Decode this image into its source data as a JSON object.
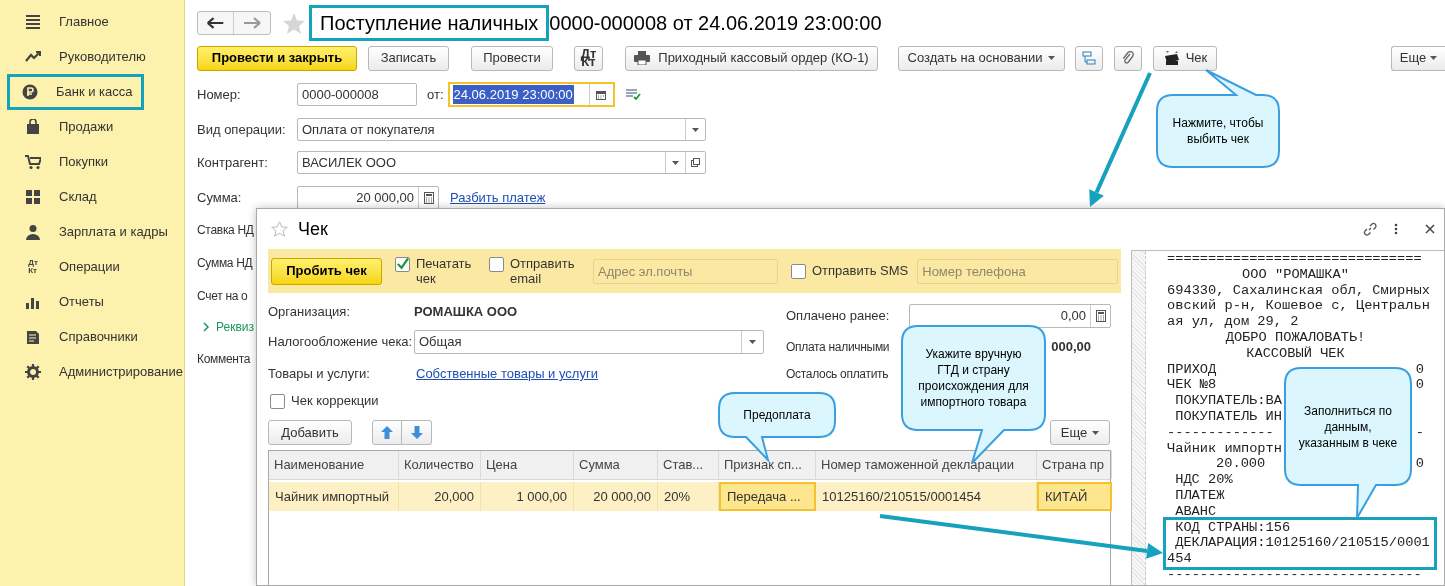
{
  "sidebar": {
    "items": [
      {
        "label": "Главное",
        "highlighted": false
      },
      {
        "label": "Руководителю",
        "highlighted": false
      },
      {
        "label": "Банк и касса",
        "highlighted": true
      },
      {
        "label": "Продажи",
        "highlighted": false
      },
      {
        "label": "Покупки",
        "highlighted": false
      },
      {
        "label": "Склад",
        "highlighted": false
      },
      {
        "label": "Зарплата и кадры",
        "highlighted": false
      },
      {
        "label": "Операции",
        "highlighted": false,
        "icon_text": "Дт\nКт"
      },
      {
        "label": "Отчеты",
        "highlighted": false
      },
      {
        "label": "Справочники",
        "highlighted": false
      },
      {
        "label": "Администрирование",
        "highlighted": false
      }
    ]
  },
  "document": {
    "title": "Поступление наличных",
    "title_highlighted": true,
    "subtitle": "0000-000008 от 24.06.2019 23:00:00",
    "toolbar": [
      {
        "kind": "primary",
        "label": "Провести и закрыть"
      },
      {
        "kind": "button",
        "label": "Записать"
      },
      {
        "kind": "button",
        "label": "Провести"
      },
      {
        "kind": "dtkt",
        "label": "Дт\nКт"
      },
      {
        "kind": "print",
        "label": "Приходный кассовый ордер (КО-1)"
      },
      {
        "kind": "menu",
        "label": "Создать на основании"
      },
      {
        "kind": "structure"
      },
      {
        "kind": "clip"
      },
      {
        "kind": "receipt",
        "label": "Чек"
      },
      {
        "kind": "more",
        "label": "Еще"
      }
    ],
    "number": {
      "label": "Номер:",
      "value": "0000-000008"
    },
    "date": {
      "label": "от:",
      "value": "24.06.2019 23:00:00",
      "selected": true
    },
    "operation": {
      "label": "Вид операции:",
      "value": "Оплата от покупателя"
    },
    "counterparty": {
      "label": "Контрагент:",
      "value": "ВАСИЛЕК ООО"
    },
    "amount": {
      "label": "Сумма:",
      "value": "20 000,00",
      "link": "Разбить платеж"
    },
    "partial_rows": [
      {
        "kind": "label",
        "text": "Ставка НД"
      },
      {
        "kind": "label",
        "text": "Сумма НД"
      },
      {
        "kind": "label",
        "text": "Счет на о"
      },
      {
        "kind": "group",
        "text": "Реквиз",
        "expanded": false
      },
      {
        "kind": "label",
        "text": "Коммента"
      }
    ]
  },
  "receipt_dialog": {
    "title": "Чек",
    "command_bar": {
      "button": "Пробить чек",
      "print": {
        "label": "Печатать\nчек",
        "checked": true
      },
      "email": {
        "label": "Отправить\nemail",
        "checked": false,
        "placeholder": "Адрес эл.почты"
      },
      "sms": {
        "label": "Отправить SMS",
        "checked": false,
        "placeholder": "Номер телефона"
      }
    },
    "organization": {
      "label": "Организация:",
      "value": "РОМАШКА ООО"
    },
    "taxation": {
      "label": "Налогообложение чека:",
      "value": "Общая"
    },
    "goods": {
      "label": "Товары и услуги:",
      "link": "Собственные товары и услуги"
    },
    "correction": {
      "label": "Чек коррекции",
      "checked": false
    },
    "paid_before": {
      "label": "Оплачено ранее:",
      "value": "0,00"
    },
    "cash": {
      "label": "Оплата наличными",
      "value": "000,00"
    },
    "remaining": {
      "label": "Осталось оплатить"
    },
    "add_button": "Добавить",
    "more_button": "Еще",
    "table": {
      "columns": [
        {
          "label": "Наименование",
          "numeric": false
        },
        {
          "label": "Количество",
          "numeric": true
        },
        {
          "label": "Цена",
          "numeric": true
        },
        {
          "label": "Сумма",
          "numeric": true
        },
        {
          "label": "Став...",
          "numeric": false
        },
        {
          "label": "Признак сп...",
          "numeric": false
        },
        {
          "label": "Номер таможенной декларации",
          "numeric": false
        },
        {
          "label": "Страна пр",
          "numeric": false
        }
      ],
      "rows": [
        {
          "selected": true,
          "cells": [
            {
              "text": "Чайник импортный",
              "highlighted": false
            },
            {
              "text": "20,000",
              "highlighted": false
            },
            {
              "text": "1 000,00",
              "highlighted": false
            },
            {
              "text": "20 000,00",
              "highlighted": false
            },
            {
              "text": "20%",
              "highlighted": false
            },
            {
              "text": "Передача ...",
              "highlighted": true
            },
            {
              "text": "10125160/210515/0001454",
              "highlighted": false
            },
            {
              "text": "КИТАЙ",
              "highlighted": true
            }
          ]
        }
      ]
    }
  },
  "receipt": {
    "lines": [
      {
        "text": "===============================",
        "kind": "plain",
        "highlighted": false
      },
      {
        "text": "ООО \"РОМАШКА\"",
        "kind": "centered",
        "highlighted": false
      },
      {
        "text": "694330, Сахалинская обл, Смирных",
        "kind": "plain",
        "highlighted": false
      },
      {
        "text": "овский р-н, Кошевое с, Центральн",
        "kind": "plain",
        "highlighted": false
      },
      {
        "text": "ая ул, дом 29, 2",
        "kind": "plain",
        "highlighted": false
      },
      {
        "text": "ДОБРО ПОЖАЛОВАТЬ!",
        "kind": "centered",
        "highlighted": false
      },
      {
        "text": "КАССОВЫЙ ЧЕК",
        "kind": "centered",
        "highlighted": false
      },
      {
        "text": "ПРИХОД",
        "tail": "0",
        "kind": "plain",
        "highlighted": false
      },
      {
        "text": "ЧЕК №8",
        "tail": "0",
        "kind": "plain",
        "highlighted": false
      },
      {
        "text": "ПОКУПАТЕЛЬ:ВА",
        "kind": "indented",
        "highlighted": false
      },
      {
        "text": "ПОКУПАТЕЛЬ ИН",
        "kind": "indented",
        "highlighted": false
      },
      {
        "text": "-------------",
        "tail": "-",
        "kind": "plain",
        "highlighted": false
      },
      {
        "text": "Чайник импортн",
        "kind": "plain",
        "highlighted": false
      },
      {
        "text": "20.000",
        "tail": "0",
        "kind": "quantity",
        "highlighted": false
      },
      {
        "text": "НДС 20%",
        "kind": "indented",
        "highlighted": false
      },
      {
        "text": "ПЛАТЕЖ",
        "kind": "indented",
        "highlighted": false
      },
      {
        "text": "АВАНС",
        "kind": "indented",
        "highlighted": false
      },
      {
        "text": "КОД СТРАНЫ:156",
        "kind": "indented",
        "highlighted": true
      },
      {
        "text": "ДЕКЛАРАЦИЯ:10125160/210515/0001",
        "kind": "indented",
        "highlighted": true
      },
      {
        "text": "454",
        "kind": "plain",
        "highlighted": true
      },
      {
        "text": "-------------------------------",
        "kind": "plain",
        "highlighted": false
      }
    ]
  },
  "callouts": [
    {
      "text": "Нажмите, чтобы\nвыбить чек"
    },
    {
      "text": "Предоплата"
    },
    {
      "text": "Укажите вручную\nГТД и страну\nпроисхождения для\nимпортного товара"
    },
    {
      "text": "Заполниться по\nданным,\nуказанным в чеке"
    }
  ]
}
